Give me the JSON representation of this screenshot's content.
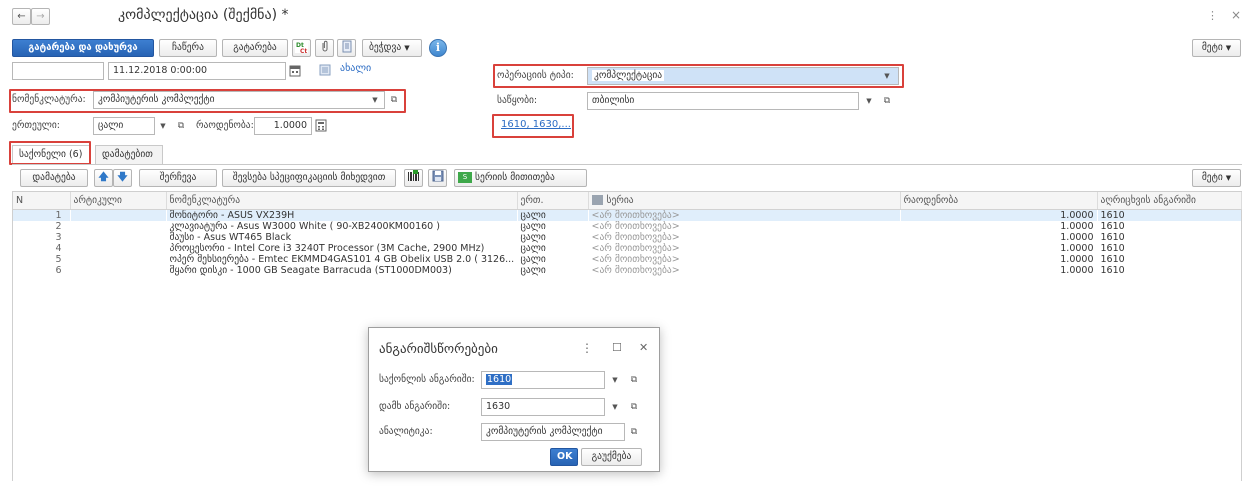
{
  "window": {
    "title": "კომპლექტაცია (შექმნა) *",
    "more_icon": "kebab-vertical-icon",
    "close_glyph": "×"
  },
  "nav": {
    "back": "←",
    "forward": "→"
  },
  "toolbar": {
    "post_and_close": "გატარება და დახურვა",
    "save": "ჩაწერა",
    "post": "გატარება",
    "create_based_on": "ბეჭდვა",
    "more": "მეტი",
    "dt_kt_label": "Dt Ct"
  },
  "header": {
    "number_value": "",
    "date_value": "11.12.2018 0:00:00",
    "new_label": "ახალი",
    "operation_type_label": "ოპერაციის ტიპი:",
    "operation_type_value": "კომპლექტაცია",
    "nomenclature_label": "ნომენკლატურა:",
    "nomenclature_value": "კომპიუტერის კომპლექტი",
    "warehouse_label": "საწყობი:",
    "warehouse_value": "თბილისი",
    "unit_label": "ერთეული:",
    "unit_value": "ცალი",
    "quantity_label": "რაოდენობა:",
    "quantity_value": "1.0000",
    "accounts_link": "1610, 1630,..."
  },
  "tabs": [
    {
      "label": "საქონელი (6)",
      "active": true
    },
    {
      "label": "დამატებით",
      "active": false
    }
  ],
  "table_toolbar": {
    "add": "დამატება",
    "select": "შერჩევა",
    "fill_by_spec": "შევსება სპეციფიკაციის მიხედვით",
    "fill_series": "სერიის მითითება",
    "more": "მეტი"
  },
  "table": {
    "columns": [
      "N",
      "არტიკული",
      "ნომენკლატურა",
      "ერთ.",
      "სერია",
      "რაოდენობა",
      "აღრიცხვის ანგარიში"
    ],
    "rows": [
      {
        "n": "1",
        "article": "",
        "name": "მონიტორი - ASUS VX239H",
        "unit": "ცალი",
        "series": "<არ მოითხოვება>",
        "qty": "1.0000",
        "account": "1610"
      },
      {
        "n": "2",
        "article": "",
        "name": "კლავიატურა - Asus W3000 White ( 90-XB2400KM00160 )",
        "unit": "ცალი",
        "series": "<არ მოითხოვება>",
        "qty": "1.0000",
        "account": "1610"
      },
      {
        "n": "3",
        "article": "",
        "name": "მაუსი - Asus WT465 Black",
        "unit": "ცალი",
        "series": "<არ მოითხოვება>",
        "qty": "1.0000",
        "account": "1610"
      },
      {
        "n": "4",
        "article": "",
        "name": "პროცესორი - Intel Core i3 3240T Processor (3M Cache, 2900 MHz)",
        "unit": "ცალი",
        "series": "<არ მოითხოვება>",
        "qty": "1.0000",
        "account": "1610"
      },
      {
        "n": "5",
        "article": "",
        "name": "ოპერ მეხსიერება - Emtec EKMMD4GAS101 4 GB Obelix USB 2.0 ( 3126...",
        "unit": "ცალი",
        "series": "<არ მოითხოვება>",
        "qty": "1.0000",
        "account": "1610"
      },
      {
        "n": "6",
        "article": "",
        "name": "მყარი დისკი - 1000 GB Seagate Barracuda (ST1000DM003)",
        "unit": "ცალი",
        "series": "<არ მოითხოვება>",
        "qty": "1.0000",
        "account": "1610"
      }
    ]
  },
  "dialog": {
    "title": "ანგარიშსწორებები",
    "goods_account_label": "საქონლის ანგარიში:",
    "goods_account_value": "1610",
    "vat_account_label": "დამხ ანგარიში:",
    "vat_account_value": "1630",
    "analytics_label": "ანალიტიკა:",
    "analytics_value": "კომპიუტერის კომპლექტი",
    "ok": "OK",
    "cancel": "გაუქმება",
    "more_glyph": "⋮",
    "maximize_glyph": "☐",
    "close_glyph": "✕"
  },
  "colors": {
    "accent": "#2763b4",
    "highlight": "#d9413b",
    "selection": "#e0eefb"
  }
}
